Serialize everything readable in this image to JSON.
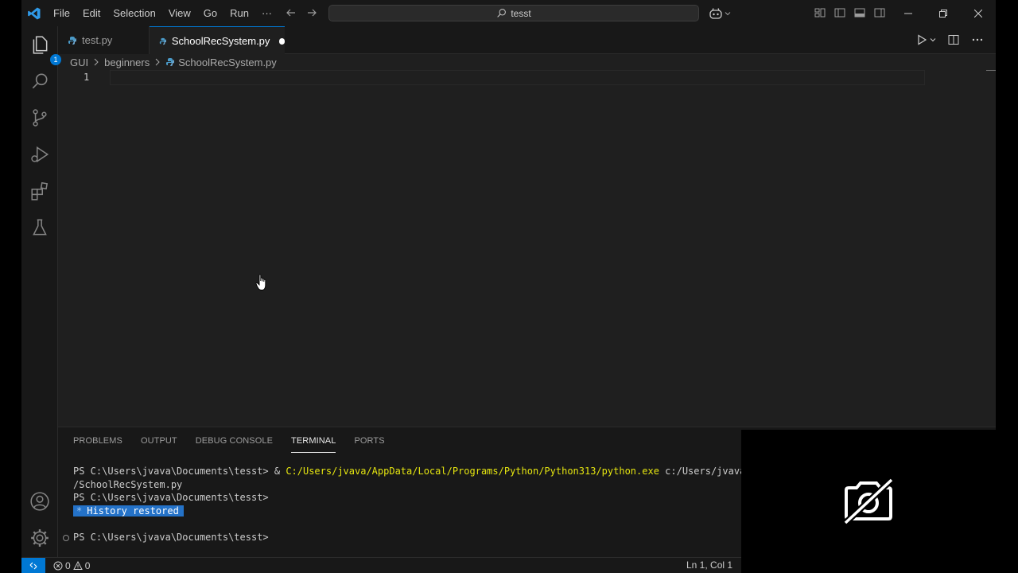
{
  "menu": [
    "File",
    "Edit",
    "Selection",
    "View",
    "Go",
    "Run",
    "···"
  ],
  "search": {
    "text": "tesst"
  },
  "activity": {
    "explorer_badge": "1"
  },
  "tabs": [
    {
      "label": "test.py",
      "active": false
    },
    {
      "label": "SchoolRecSystem.py",
      "active": true,
      "dirty": true
    }
  ],
  "breadcrumb": [
    "GUI",
    "beginners",
    "SchoolRecSystem.py"
  ],
  "editor": {
    "line_numbers": [
      "1"
    ]
  },
  "panel": {
    "tabs": [
      "PROBLEMS",
      "OUTPUT",
      "DEBUG CONSOLE",
      "TERMINAL",
      "PORTS"
    ],
    "active_tab": "TERMINAL"
  },
  "terminal": {
    "line1_prompt": "PS C:\\Users\\jvava\\Documents\\tesst> & ",
    "line1_exe": "C:/Users/jvava/AppData/Local/Programs/Python/Python313/python.exe",
    "line1_arg": " c:/Users/jvava/Do",
    "line2": "/SchoolRecSystem.py",
    "line3": "PS C:\\Users\\jvava\\Documents\\tesst>",
    "history_star": "*",
    "history": "History restored",
    "line5": "PS C:\\Users\\jvava\\Documents\\tesst>"
  },
  "status": {
    "errors": "0",
    "warnings": "0",
    "position": "Ln 1, Col 1"
  },
  "colors": {
    "accent": "#0078d4",
    "editor_bg": "#1f1f1f",
    "chrome_bg": "#181818",
    "terminal_yellow": "#e5e510"
  }
}
